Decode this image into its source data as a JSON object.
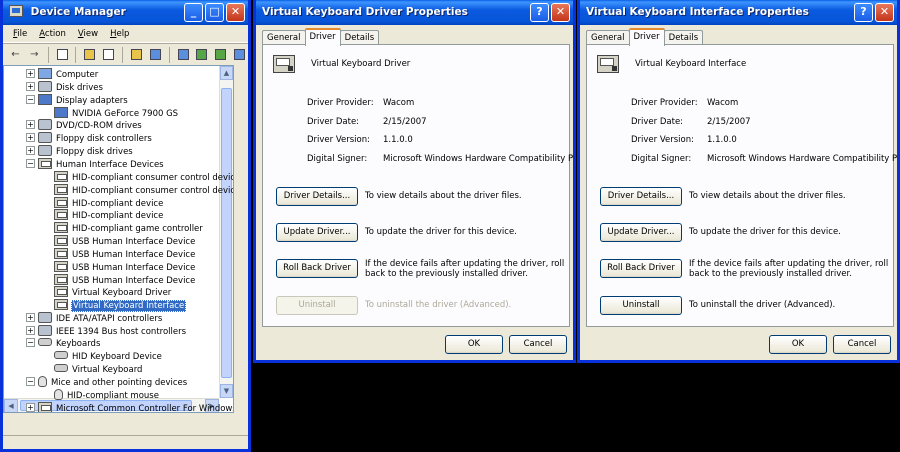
{
  "device_manager": {
    "title": "Device Manager",
    "menu": [
      "File",
      "Action",
      "View",
      "Help"
    ],
    "tree": [
      {
        "label": "Computer",
        "indent": 1,
        "expander": "+",
        "icon": "comp"
      },
      {
        "label": "Disk drives",
        "indent": 1,
        "expander": "+",
        "icon": "disk"
      },
      {
        "label": "Display adapters",
        "indent": 1,
        "expander": "−",
        "icon": "disp"
      },
      {
        "label": "NVIDIA GeForce 7900 GS",
        "indent": 2,
        "expander": "",
        "icon": "disp"
      },
      {
        "label": "DVD/CD-ROM drives",
        "indent": 1,
        "expander": "+",
        "icon": "disk"
      },
      {
        "label": "Floppy disk controllers",
        "indent": 1,
        "expander": "+",
        "icon": "disk"
      },
      {
        "label": "Floppy disk drives",
        "indent": 1,
        "expander": "+",
        "icon": "disk"
      },
      {
        "label": "Human Interface Devices",
        "indent": 1,
        "expander": "−",
        "icon": "hid"
      },
      {
        "label": "HID-compliant consumer control device",
        "indent": 2,
        "expander": "",
        "icon": "hid"
      },
      {
        "label": "HID-compliant consumer control device",
        "indent": 2,
        "expander": "",
        "icon": "hid"
      },
      {
        "label": "HID-compliant device",
        "indent": 2,
        "expander": "",
        "icon": "hid"
      },
      {
        "label": "HID-compliant device",
        "indent": 2,
        "expander": "",
        "icon": "hid"
      },
      {
        "label": "HID-compliant game controller",
        "indent": 2,
        "expander": "",
        "icon": "hid"
      },
      {
        "label": "USB Human Interface Device",
        "indent": 2,
        "expander": "",
        "icon": "hid"
      },
      {
        "label": "USB Human Interface Device",
        "indent": 2,
        "expander": "",
        "icon": "hid"
      },
      {
        "label": "USB Human Interface Device",
        "indent": 2,
        "expander": "",
        "icon": "hid"
      },
      {
        "label": "USB Human Interface Device",
        "indent": 2,
        "expander": "",
        "icon": "hid"
      },
      {
        "label": "Virtual Keyboard Driver",
        "indent": 2,
        "expander": "",
        "icon": "hid"
      },
      {
        "label": "Virtual Keyboard Interface",
        "indent": 2,
        "expander": "",
        "icon": "hid",
        "selected": true
      },
      {
        "label": "IDE ATA/ATAPI controllers",
        "indent": 1,
        "expander": "+",
        "icon": "disk"
      },
      {
        "label": "IEEE 1394 Bus host controllers",
        "indent": 1,
        "expander": "+",
        "icon": "disk"
      },
      {
        "label": "Keyboards",
        "indent": 1,
        "expander": "−",
        "icon": "kb"
      },
      {
        "label": "HID Keyboard Device",
        "indent": 2,
        "expander": "",
        "icon": "kb"
      },
      {
        "label": "Virtual Keyboard",
        "indent": 2,
        "expander": "",
        "icon": "kb"
      },
      {
        "label": "Mice and other pointing devices",
        "indent": 1,
        "expander": "−",
        "icon": "mouse"
      },
      {
        "label": "HID-compliant mouse",
        "indent": 2,
        "expander": "",
        "icon": "mouse"
      },
      {
        "label": "Microsoft Common Controller For Windows Class",
        "indent": 1,
        "expander": "+",
        "icon": "hid"
      }
    ]
  },
  "dialog_driver": {
    "title": "Virtual Keyboard Driver Properties",
    "tabs": [
      "General",
      "Driver",
      "Details"
    ],
    "device_name": "Virtual Keyboard Driver",
    "info": [
      {
        "key": "Driver Provider:",
        "value": "Wacom"
      },
      {
        "key": "Driver Date:",
        "value": "2/15/2007"
      },
      {
        "key": "Driver Version:",
        "value": "1.1.0.0"
      },
      {
        "key": "Digital Signer:",
        "value": "Microsoft Windows Hardware Compatibility Publ"
      }
    ],
    "buttons": [
      {
        "label": "Driver Details...",
        "desc": "To view details about the driver files.",
        "enabled": true
      },
      {
        "label": "Update Driver...",
        "desc": "To update the driver for this device.",
        "enabled": true
      },
      {
        "label": "Roll Back Driver",
        "desc": "If the device fails after updating the driver, roll back to the previously installed driver.",
        "enabled": true
      },
      {
        "label": "Uninstall",
        "desc": "To uninstall the driver (Advanced).",
        "enabled": false
      }
    ],
    "ok": "OK",
    "cancel": "Cancel"
  },
  "dialog_interface": {
    "title": "Virtual Keyboard Interface Properties",
    "tabs": [
      "General",
      "Driver",
      "Details"
    ],
    "device_name": "Virtual Keyboard Interface",
    "info": [
      {
        "key": "Driver Provider:",
        "value": "Wacom"
      },
      {
        "key": "Driver Date:",
        "value": "2/15/2007"
      },
      {
        "key": "Driver Version:",
        "value": "1.1.0.0"
      },
      {
        "key": "Digital Signer:",
        "value": "Microsoft Windows Hardware Compatibility Publ"
      }
    ],
    "buttons": [
      {
        "label": "Driver Details...",
        "desc": "To view details about the driver files.",
        "enabled": true
      },
      {
        "label": "Update Driver...",
        "desc": "To update the driver for this device.",
        "enabled": true
      },
      {
        "label": "Roll Back Driver",
        "desc": "If the device fails after updating the driver, roll back to the previously installed driver.",
        "enabled": true
      },
      {
        "label": "Uninstall",
        "desc": "To uninstall the driver (Advanced).",
        "enabled": true
      }
    ],
    "ok": "OK",
    "cancel": "Cancel"
  },
  "titlebar_buttons": {
    "minimize": "_",
    "maximize": "□",
    "close": "✕",
    "help": "?"
  }
}
